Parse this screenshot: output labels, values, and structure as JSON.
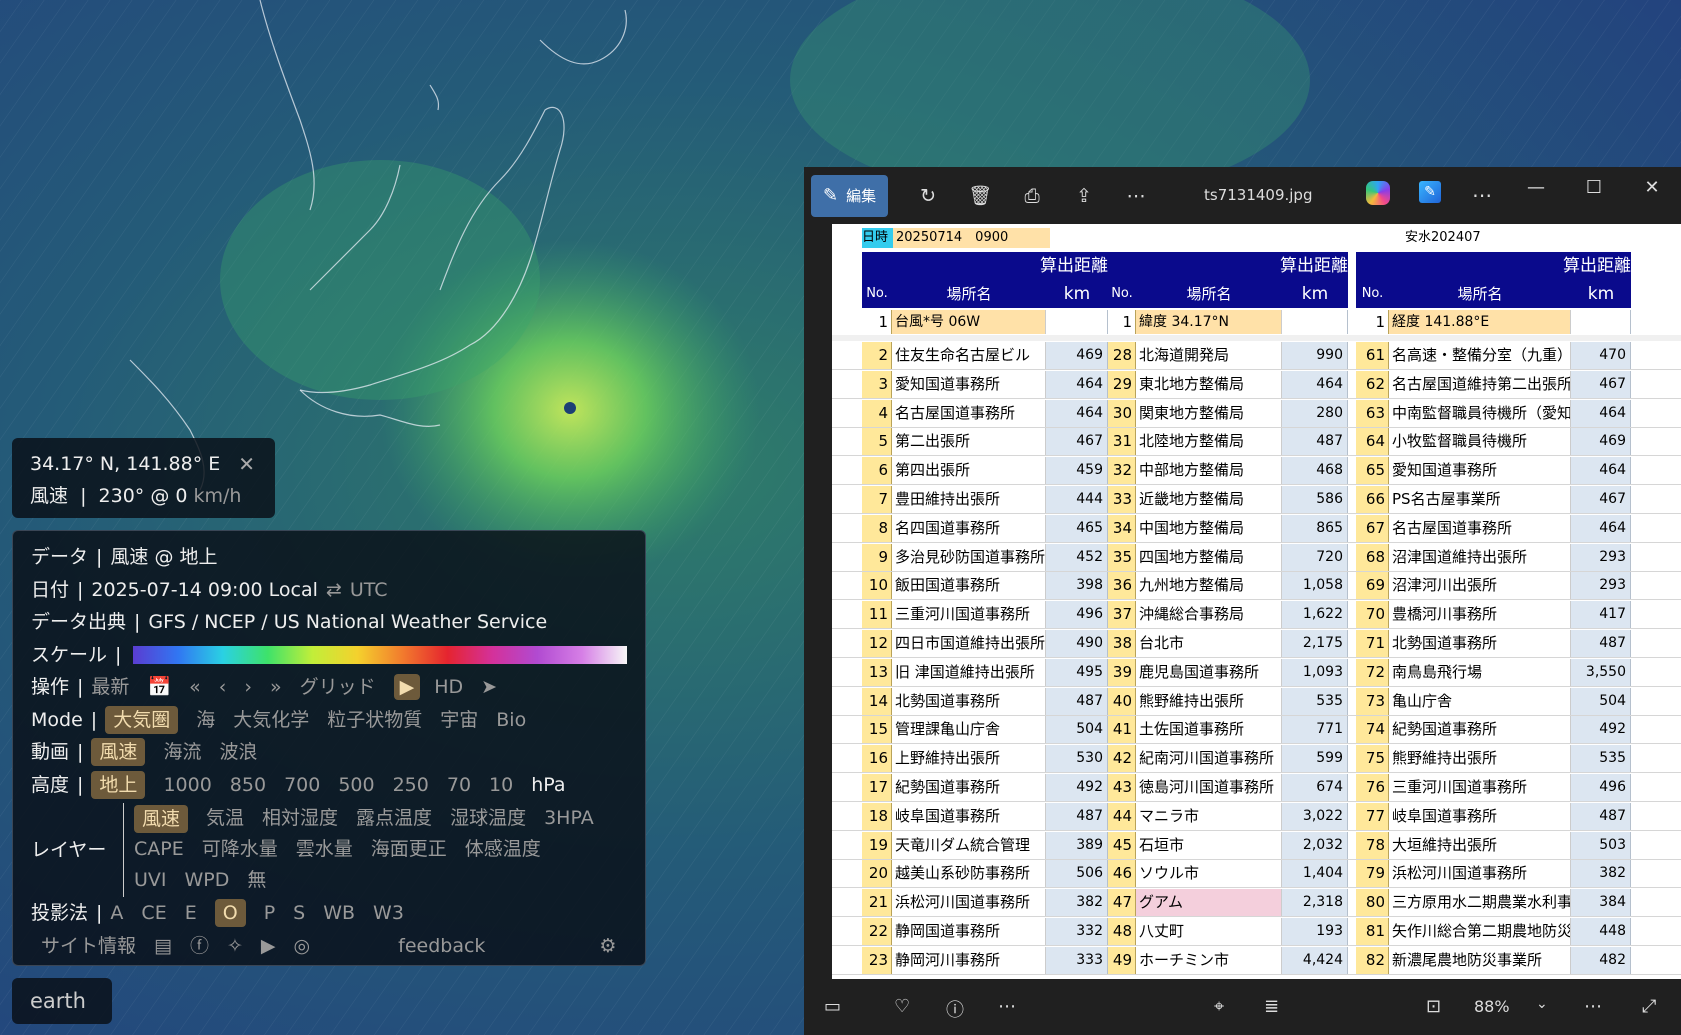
{
  "coord_box": {
    "position": "34.17° N, 141.88° E",
    "close": "✕",
    "label": "風速",
    "value": "230° @ 0",
    "unit": "km/h"
  },
  "panel": {
    "data": {
      "label": "データ",
      "value": "風速 @ 地上"
    },
    "date": {
      "label": "日付",
      "value": "2025-07-14 09:00 Local",
      "swap": "⇄",
      "alt": "UTC"
    },
    "source": {
      "label": "データ出典",
      "value": "GFS / NCEP / US National Weather Service"
    },
    "scale": {
      "label": "スケール"
    },
    "control": {
      "label": "操作",
      "latest": "最新",
      "calendar": "📅",
      "ff_back": "«",
      "back": "‹",
      "fwd": "›",
      "ff_fwd": "»",
      "grid": "グリッド",
      "play": "▶",
      "hd": "HD",
      "locate": "➤"
    },
    "mode": {
      "label": "Mode",
      "items": [
        "大気圏",
        "海",
        "大気化学",
        "粒子状物質",
        "宇宙",
        "Bio"
      ],
      "selected": 0
    },
    "anim": {
      "label": "動画",
      "items": [
        "風速",
        "海流",
        "波浪"
      ],
      "selected": 0
    },
    "height": {
      "label": "高度",
      "items": [
        "地上",
        "1000",
        "850",
        "700",
        "500",
        "250",
        "70",
        "10"
      ],
      "unit": "hPa",
      "selected": 0
    },
    "layer": {
      "label": "レイヤー",
      "row1": [
        "風速",
        "気温",
        "相対湿度",
        "露点温度",
        "湿球温度",
        "3HPA"
      ],
      "row2": [
        "CAPE",
        "可降水量",
        "雲水量",
        "海面更正",
        "体感温度"
      ],
      "row3": [
        "UVI",
        "WPD",
        "無"
      ],
      "selected": 0
    },
    "projection": {
      "label": "投影法",
      "items": [
        "A",
        "CE",
        "E",
        "O",
        "P",
        "S",
        "WB",
        "W3"
      ],
      "selected": 3
    },
    "site": {
      "label": "サイト情報",
      "feedback": "feedback"
    }
  },
  "earth_label": "earth",
  "viewer": {
    "edit": "編集",
    "filename": "ts7131409.jpg",
    "zoom": "88%",
    "sheet": {
      "datetime_label": "日時",
      "datetime_value": "20250714　0900",
      "file_label": "安水202407",
      "col_title": "算出距離",
      "no": "No.",
      "place": "場所名",
      "km": "km",
      "first_row": [
        {
          "no": "1",
          "name": "台風*号 06W"
        },
        {
          "no": "1",
          "name": "緯度 34.17°N"
        },
        {
          "no": "1",
          "name": "経度 141.88°E"
        }
      ],
      "rows": [
        [
          [
            "2",
            "住友生命名古屋ビル",
            "469"
          ],
          [
            "28",
            "北海道開発局",
            "990"
          ],
          [
            "61",
            "名高速・整備分室（九重）",
            "470"
          ]
        ],
        [
          [
            "3",
            "愛知国道事務所",
            "464"
          ],
          [
            "29",
            "東北地方整備局",
            "464"
          ],
          [
            "62",
            "名古屋国道維持第二出張所",
            "467"
          ]
        ],
        [
          [
            "4",
            "名古屋国道事務所",
            "464"
          ],
          [
            "30",
            "関東地方整備局",
            "280"
          ],
          [
            "63",
            "中南監督職員待機所（愛知県",
            "464"
          ]
        ],
        [
          [
            "5",
            "第二出張所",
            "467"
          ],
          [
            "31",
            "北陸地方整備局",
            "487"
          ],
          [
            "64",
            "小牧監督職員待機所",
            "469"
          ]
        ],
        [
          [
            "6",
            "第四出張所",
            "459"
          ],
          [
            "32",
            "中部地方整備局",
            "468"
          ],
          [
            "65",
            "愛知国道事務所",
            "464"
          ]
        ],
        [
          [
            "7",
            "豊田維持出張所",
            "444"
          ],
          [
            "33",
            "近畿地方整備局",
            "586"
          ],
          [
            "66",
            "PS名古屋事業所",
            "467"
          ]
        ],
        [
          [
            "8",
            "名四国道事務所",
            "465"
          ],
          [
            "34",
            "中国地方整備局",
            "865"
          ],
          [
            "67",
            "名古屋国道事務所",
            "464"
          ]
        ],
        [
          [
            "9",
            "多治見砂防国道事務所",
            "452"
          ],
          [
            "35",
            "四国地方整備局",
            "720"
          ],
          [
            "68",
            "沼津国道維持出張所",
            "293"
          ]
        ],
        [
          [
            "10",
            "飯田国道事務所",
            "398"
          ],
          [
            "36",
            "九州地方整備局",
            "1,058"
          ],
          [
            "69",
            "沼津河川出張所",
            "293"
          ]
        ],
        [
          [
            "11",
            "三重河川国道事務所",
            "496"
          ],
          [
            "37",
            "沖縄総合事務局",
            "1,622"
          ],
          [
            "70",
            "豊橋河川事務所",
            "417"
          ]
        ],
        [
          [
            "12",
            "四日市国道維持出張所",
            "490"
          ],
          [
            "38",
            "台北市",
            "2,175"
          ],
          [
            "71",
            "北勢国道事務所",
            "487"
          ]
        ],
        [
          [
            "13",
            "旧 津国道維持出張所",
            "495"
          ],
          [
            "39",
            "鹿児島国道事務所",
            "1,093"
          ],
          [
            "72",
            "南鳥島飛行場",
            "3,550"
          ]
        ],
        [
          [
            "14",
            "北勢国道事務所",
            "487"
          ],
          [
            "40",
            "熊野維持出張所",
            "535"
          ],
          [
            "73",
            "亀山庁舎",
            "504"
          ]
        ],
        [
          [
            "15",
            "管理課亀山庁舎",
            "504"
          ],
          [
            "41",
            "土佐国道事務所",
            "771"
          ],
          [
            "74",
            "紀勢国道事務所",
            "492"
          ]
        ],
        [
          [
            "16",
            "上野維持出張所",
            "530"
          ],
          [
            "42",
            "紀南河川国道事務所",
            "599"
          ],
          [
            "75",
            "熊野維持出張所",
            "535"
          ]
        ],
        [
          [
            "17",
            "紀勢国道事務所",
            "492"
          ],
          [
            "43",
            "徳島河川国道事務所",
            "674"
          ],
          [
            "76",
            "三重河川国道事務所",
            "496"
          ]
        ],
        [
          [
            "18",
            "岐阜国道事務所",
            "487"
          ],
          [
            "44",
            "マニラ市",
            "3,022"
          ],
          [
            "77",
            "岐阜国道事務所",
            "487"
          ]
        ],
        [
          [
            "19",
            "天竜川ダム統合管理",
            "389"
          ],
          [
            "45",
            "石垣市",
            "2,032"
          ],
          [
            "78",
            "大垣維持出張所",
            "503"
          ]
        ],
        [
          [
            "20",
            "越美山系砂防事務所",
            "506"
          ],
          [
            "46",
            "ソウル市",
            "1,404"
          ],
          [
            "79",
            "浜松河川国道事務所",
            "382"
          ]
        ],
        [
          [
            "21",
            "浜松河川国道事務所",
            "382"
          ],
          [
            "47",
            "グアム",
            "2,318"
          ],
          [
            "80",
            "三方原用水二期農業水利事業",
            "384"
          ]
        ],
        [
          [
            "22",
            "静岡国道事務所",
            "332"
          ],
          [
            "48",
            "八丈町",
            "193"
          ],
          [
            "81",
            "矢作川総合第二期農地防災事業",
            "448"
          ]
        ],
        [
          [
            "23",
            "静岡河川事務所",
            "333"
          ],
          [
            "49",
            "ホーチミン市",
            "4,424"
          ],
          [
            "82",
            "新濃尾農地防災事業所",
            "482"
          ]
        ]
      ]
    }
  },
  "colors": {
    "accent": "#6d5a3b",
    "edit_button": "#3f6fa8",
    "sheet_header": "#0a0a8c",
    "no_column": "#ffe89a",
    "km_column": "#dce6f1",
    "guam_highlight": "#f4cfdc",
    "datetime_label_bg": "#33ccee"
  },
  "icons": [
    "close-icon",
    "calendar-icon",
    "play-icon",
    "location-icon",
    "book-icon",
    "facebook-icon",
    "bluesky-icon",
    "youtube-icon",
    "instagram-icon",
    "gear-icon",
    "edit-icon",
    "rotate-icon",
    "trash-icon",
    "print-icon",
    "share-icon",
    "more-icon",
    "copilot-icon",
    "paint-icon",
    "minimize-icon",
    "maximize-icon",
    "close-window-icon",
    "filmstrip-icon",
    "heart-icon",
    "info-icon",
    "scan-icon",
    "text-icon",
    "fit-icon",
    "chevron-down-icon",
    "fullscreen-icon"
  ]
}
